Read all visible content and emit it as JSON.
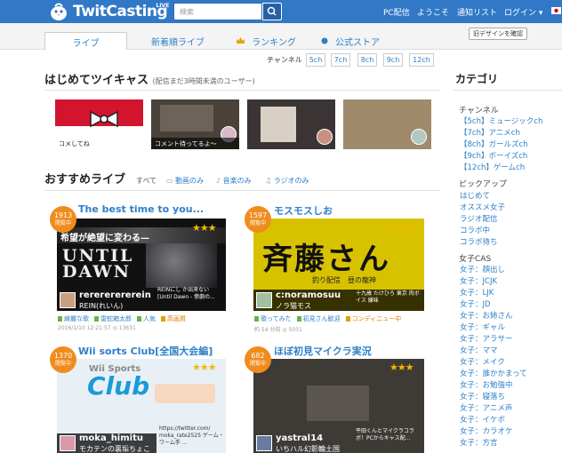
{
  "header": {
    "brand": "TwitCasting",
    "brand_sup": "LIVE",
    "search_placeholder": "検索",
    "nav": [
      "PC配信",
      "ようこそ",
      "通知リスト",
      "ログイン ▾"
    ]
  },
  "tabs": [
    "ライブ",
    "新着順ライブ",
    "ランキング",
    "公式ストア"
  ],
  "old_design_button": "旧デザインを確認",
  "channel": {
    "label": "チャンネル",
    "buttons": [
      "5ch",
      "7ch",
      "8ch",
      "9ch",
      "12ch"
    ]
  },
  "beginners": {
    "title": "はじめてツイキャス",
    "subtitle": "(配信まだ3時間未満のユーザー)",
    "items": [
      {
        "caption": "コメしてね"
      },
      {
        "caption": "コメント待ってるよ〜"
      },
      {
        "caption": ""
      },
      {
        "caption": ""
      }
    ]
  },
  "recommended": {
    "title": "おすすめライブ",
    "filters": [
      "すべて",
      "動画のみ",
      "音楽のみ",
      "ラジオのみ"
    ]
  },
  "cards": [
    {
      "views": "1913",
      "badge_sub": "閲覧中",
      "title": "The best time to you...",
      "banner": "希望が絶望に変わる—",
      "game": "UNTIL DAWN",
      "name": "rerererererein",
      "sub": "REIN(れいん)",
      "desc": "REINにし か出来ない [Until Dawn - 惨劇の...",
      "tags": [
        "綺麗な歌",
        "雷蛇箱太郎",
        "人気"
      ],
      "tag_orange": "高画質",
      "meta": "2016/1/10 12:21:57 ◎ 13631"
    },
    {
      "views": "1597",
      "badge_sub": "閲覧中",
      "title": "モスモスしお",
      "big_text": "斉藤さん",
      "small_text": "釣り配信　昼の龍神",
      "name": "c:noramosuu",
      "sub": "ノラ猫モス",
      "desc": "十九歳 たけひろ 東京 肉ボイス 嫌味",
      "tags": [
        "歌ってみた",
        "初見さん歓迎"
      ],
      "tag_orange": "コンディニュー中",
      "meta": "約 54 分前 ◎ 5031"
    },
    {
      "views": "1370",
      "badge_sub": "閲覧中",
      "title": "Wii sorts Club[全国大会編]",
      "logo_top": "Wii Sports",
      "logo_main": "Club",
      "name": "moka_himitu",
      "sub": "モカテンの裏垢ちょこ",
      "desc": "https://twitter.com/ moka_rate2525 ゲーム・ワーム手 ..."
    },
    {
      "views": "682",
      "badge_sub": "閲覧中",
      "title": "ほぼ初見マイクラ実況",
      "name": "yastral14",
      "sub": "いちハル幻影輪土国",
      "desc": "平田くんとマイクラコラボ！PCからキャス配..."
    }
  ],
  "categories": {
    "title": "カテゴリ",
    "channel_heading": "チャンネル",
    "channels": [
      "【5ch】ミュージックch",
      "【7ch】アニメch",
      "【8ch】ガールズch",
      "【9ch】ボーイズch",
      "【12ch】ゲームch"
    ],
    "pickup_heading": "ピックアップ",
    "pickup": [
      "はじめて",
      "オススメ女子",
      "ラジオ配信",
      "コラボ中",
      "コラボ待ち"
    ],
    "girls_heading": "女子CAS",
    "girls": [
      "女子：顔出し",
      "女子：JCJK",
      "女子：LJK",
      "女子：JD",
      "女子：お姉さん",
      "女子：ギャル",
      "女子：アラサー",
      "女子：ママ",
      "女子：メイク",
      "女子：誰かかまって",
      "女子：お勉強中",
      "女子：寝落ち",
      "女子：アニメ声",
      "女子：イケボ",
      "女子：カラオケ",
      "女子：方言"
    ]
  },
  "colors": {
    "header": "#3178c6",
    "link": "#2d7fc8",
    "badge": "#f08c1e",
    "star": "#f0b800"
  }
}
